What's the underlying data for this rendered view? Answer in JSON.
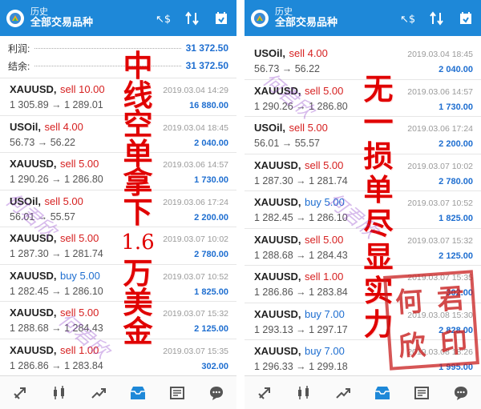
{
  "colors": {
    "app_bar": "#1e88d8",
    "sell": "#d62020",
    "buy": "#1e6ed0",
    "profit": "#1e6ed0",
    "overlay_red": "#e00000"
  },
  "left": {
    "header": {
      "subtitle": "历史",
      "title": "全部交易品种"
    },
    "summary": {
      "profit_label": "利润:",
      "profit_value": "31 372.50",
      "balance_label": "结余:",
      "balance_value": "31 372.50"
    },
    "trades": [
      {
        "symbol": "XAUUSD,",
        "side": "sell 10.00",
        "side_type": "sell",
        "prices": "1 305.89 → 1 289.01",
        "time": "2019.03.04 14:29",
        "profit": "16 880.00"
      },
      {
        "symbol": "USOil,",
        "side": "sell 4.00",
        "side_type": "sell",
        "prices": "56.73 → 56.22",
        "time": "2019.03.04 18:45",
        "profit": "2 040.00"
      },
      {
        "symbol": "XAUUSD,",
        "side": "sell 5.00",
        "side_type": "sell",
        "prices": "1 290.26 → 1 286.80",
        "time": "2019.03.06 14:57",
        "profit": "1 730.00"
      },
      {
        "symbol": "USOil,",
        "side": "sell 5.00",
        "side_type": "sell",
        "prices": "56.01 → 55.57",
        "time": "2019.03.06 17:24",
        "profit": "2 200.00"
      },
      {
        "symbol": "XAUUSD,",
        "side": "sell 5.00",
        "side_type": "sell",
        "prices": "1 287.30 → 1 281.74",
        "time": "2019.03.07 10:02",
        "profit": "2 780.00"
      },
      {
        "symbol": "XAUUSD,",
        "side": "buy 5.00",
        "side_type": "buy",
        "prices": "1 282.45 → 1 286.10",
        "time": "2019.03.07 10:52",
        "profit": "1 825.00"
      },
      {
        "symbol": "XAUUSD,",
        "side": "sell 5.00",
        "side_type": "sell",
        "prices": "1 288.68 → 1 284.43",
        "time": "2019.03.07 15:32",
        "profit": "2 125.00"
      },
      {
        "symbol": "XAUUSD,",
        "side": "sell 1.00",
        "side_type": "sell",
        "prices": "1 286.86 → 1 283.84",
        "time": "2019.03.07 15:35",
        "profit": "302.00"
      }
    ],
    "overlay_chars": [
      "中",
      "线",
      "空",
      "单",
      "拿",
      "下"
    ],
    "overlay_num": "1.6",
    "overlay_chars2": [
      "万",
      "美",
      "金"
    ]
  },
  "right": {
    "header": {
      "subtitle": "历史",
      "title": "全部交易品种"
    },
    "trades": [
      {
        "symbol": "USOil,",
        "side": "sell 4.00",
        "side_type": "sell",
        "prices": "56.73 → 56.22",
        "time": "2019.03.04 18:45",
        "profit": "2 040.00"
      },
      {
        "symbol": "XAUUSD,",
        "side": "sell 5.00",
        "side_type": "sell",
        "prices": "1 290.26 → 1 286.80",
        "time": "2019.03.06 14:57",
        "profit": "1 730.00"
      },
      {
        "symbol": "USOil,",
        "side": "sell 5.00",
        "side_type": "sell",
        "prices": "56.01 → 55.57",
        "time": "2019.03.06 17:24",
        "profit": "2 200.00"
      },
      {
        "symbol": "XAUUSD,",
        "side": "sell 5.00",
        "side_type": "sell",
        "prices": "1 287.30 → 1 281.74",
        "time": "2019.03.07 10:02",
        "profit": "2 780.00"
      },
      {
        "symbol": "XAUUSD,",
        "side": "buy 5.00",
        "side_type": "buy",
        "prices": "1 282.45 → 1 286.10",
        "time": "2019.03.07 10:52",
        "profit": "1 825.00"
      },
      {
        "symbol": "XAUUSD,",
        "side": "sell 5.00",
        "side_type": "sell",
        "prices": "1 288.68 → 1 284.43",
        "time": "2019.03.07 15:32",
        "profit": "2 125.00"
      },
      {
        "symbol": "XAUUSD,",
        "side": "sell 1.00",
        "side_type": "sell",
        "prices": "1 286.86 → 1 283.84",
        "time": "2019.03.07 15:35",
        "profit": "302.00"
      },
      {
        "symbol": "XAUUSD,",
        "side": "buy 7.00",
        "side_type": "buy",
        "prices": "1 293.13 → 1 297.17",
        "time": "2019.03.08 15:30",
        "profit": "2 828.00"
      },
      {
        "symbol": "XAUUSD,",
        "side": "buy 7.00",
        "side_type": "buy",
        "prices": "1 296.33 → 1 299.18",
        "time": "2019.03.08 18:26",
        "profit": "1 995.00"
      }
    ],
    "overlay_chars": [
      "无",
      "一",
      "损",
      "单",
      "尽",
      "显",
      "实",
      "力"
    ],
    "seal_chars": [
      "何",
      "君",
      "欣",
      "印"
    ]
  },
  "watermarks": [
    "何君欣",
    "何君欣",
    "何君欣",
    "何君欣"
  ],
  "nav_icons": [
    "trade-icon",
    "chart-icon",
    "analytics-icon",
    "history-icon",
    "news-icon",
    "chat-icon"
  ]
}
